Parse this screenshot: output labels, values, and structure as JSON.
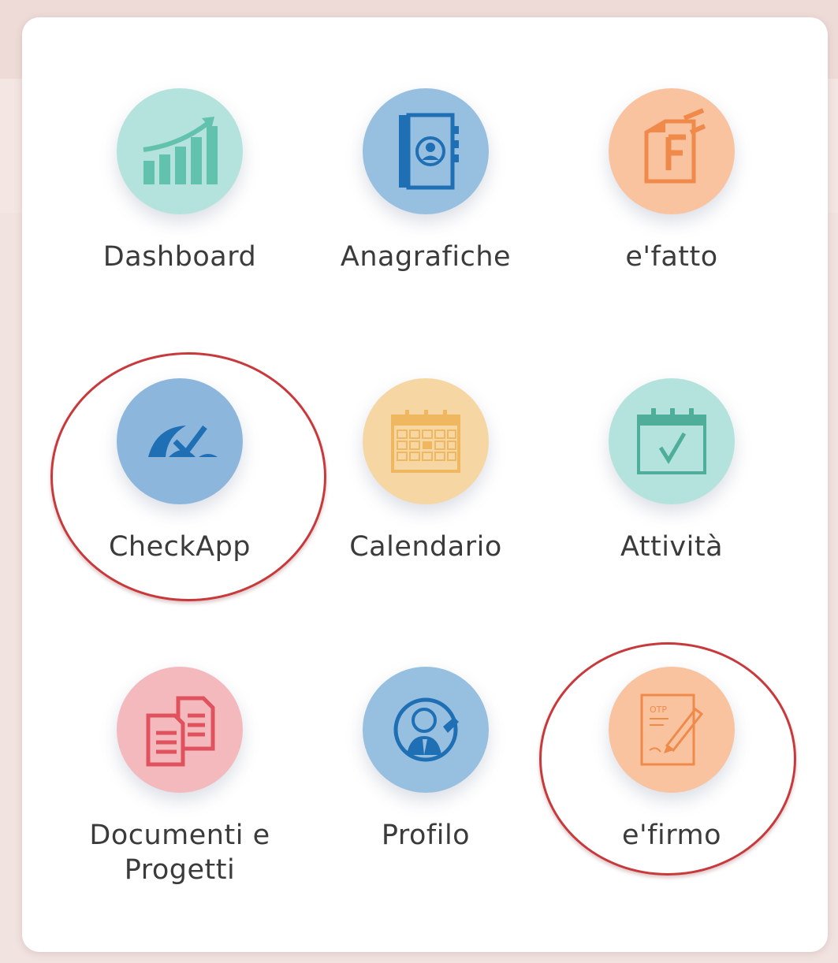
{
  "apps": [
    {
      "label": "Dashboard",
      "icon": "chart-growth-icon",
      "color": "#b3e3dc"
    },
    {
      "label": "Anagrafiche",
      "icon": "address-book-icon",
      "color": "#97bfdf"
    },
    {
      "label": "e'fatto",
      "icon": "invoice-document-icon",
      "color": "#f9c39f"
    },
    {
      "label": "CheckApp",
      "icon": "checkapp-icon",
      "color": "#8db6dc"
    },
    {
      "label": "Calendario",
      "icon": "calendar-grid-icon",
      "color": "#f6d7a3"
    },
    {
      "label": "Attività",
      "icon": "calendar-check-icon",
      "color": "#b3e3dc"
    },
    {
      "label": "Documenti e Progetti",
      "icon": "documents-icon",
      "color": "#f4b9bd"
    },
    {
      "label": "Profilo",
      "icon": "user-profile-icon",
      "color": "#97bfdf"
    },
    {
      "label": "e'firmo",
      "icon": "signature-pen-icon",
      "color": "#f9c39f"
    }
  ],
  "efirmo_otp_text": "OTP",
  "colors": {
    "highlight_ring": "#c8393c",
    "label_text": "#3b3b3b"
  }
}
